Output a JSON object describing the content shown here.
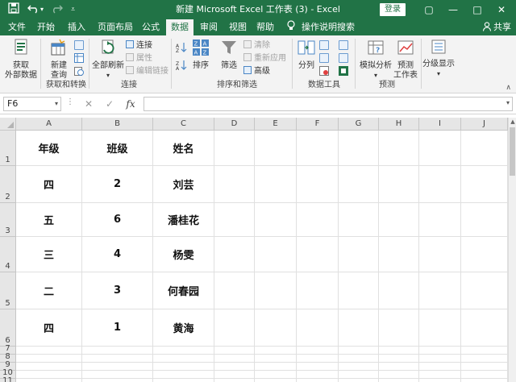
{
  "titlebar": {
    "title": "新建 Microsoft Excel 工作表 (3)  -  Excel",
    "login_label": "登录",
    "save_icon": "save-icon",
    "undo_icon": "undo-icon",
    "redo_icon": "redo-icon",
    "customize_icon": "customize-quick-access-icon",
    "minimize": "—",
    "restore": "□",
    "close": "✕",
    "ribbon_options": "▢"
  },
  "tabs": [
    {
      "label": "文件"
    },
    {
      "label": "开始"
    },
    {
      "label": "插入"
    },
    {
      "label": "页面布局"
    },
    {
      "label": "公式"
    },
    {
      "label": "数据"
    },
    {
      "label": "审阅"
    },
    {
      "label": "视图"
    },
    {
      "label": "帮助"
    }
  ],
  "tab_search": "操作说明搜索",
  "share": "共享",
  "ribbon": {
    "get_external_1": "获取",
    "get_external_2": "外部数据",
    "new_query_1": "新建",
    "new_query_2": "查询",
    "group_get_transform": "获取和转换",
    "refresh_all": "全部刷新",
    "connections": "连接",
    "properties": "属性",
    "edit_links": "编辑链接",
    "group_connections": "连接",
    "sort": "排序",
    "filter": "筛选",
    "clear": "清除",
    "reapply": "重新应用",
    "advanced": "高级",
    "group_sort_filter": "排序和筛选",
    "text_to_columns": "分列",
    "group_data_tools": "数据工具",
    "what_if_1": "模拟分析",
    "forecast_1": "预测",
    "forecast_2": "工作表",
    "group_forecast": "预测",
    "outline": "分级显示"
  },
  "formula_bar": {
    "name_box": "F6",
    "cancel": "✕",
    "enter": "✓",
    "fx": "fx",
    "value": ""
  },
  "sheet": {
    "columns": [
      "A",
      "B",
      "C",
      "D",
      "E",
      "F",
      "G",
      "H",
      "I",
      "J"
    ],
    "rows": [
      "1",
      "2",
      "3",
      "4",
      "5",
      "6",
      "7",
      "8",
      "9",
      "10",
      "11"
    ],
    "cells": [
      [
        "年级",
        "班级",
        "姓名"
      ],
      [
        "四",
        "2",
        "刘芸"
      ],
      [
        "五",
        "6",
        "潘桂花"
      ],
      [
        "三",
        "4",
        "杨雯"
      ],
      [
        "二",
        "3",
        "何春园"
      ],
      [
        "四",
        "1",
        "黄海"
      ]
    ]
  },
  "colors": {
    "brand": "#217346",
    "ribbon_bg": "#f3f3f3",
    "header_bg": "#e6e6e6",
    "grid": "#e0e0e0"
  }
}
